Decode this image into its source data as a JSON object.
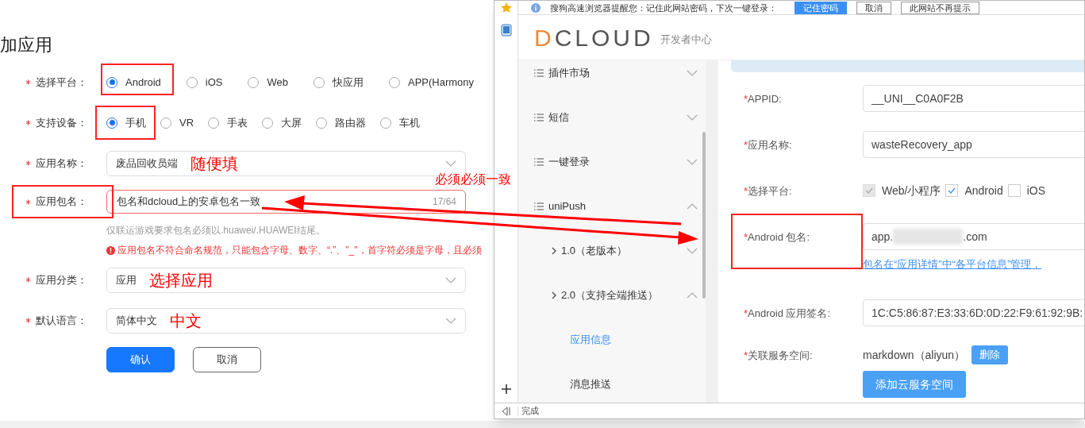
{
  "left_form": {
    "title": "加应用",
    "fields": [
      {
        "kind": "radio",
        "required": true,
        "label": "选择平台：",
        "options": [
          {
            "label": "Android",
            "selected": true
          },
          {
            "label": "iOS",
            "selected": false
          },
          {
            "label": "Web",
            "selected": false
          },
          {
            "label": "快应用",
            "selected": false
          },
          {
            "label": "APP(Harmony",
            "selected": false
          }
        ]
      },
      {
        "kind": "radio",
        "required": true,
        "label": "支持设备：",
        "options": [
          {
            "label": "手机",
            "selected": true
          },
          {
            "label": "VR",
            "selected": false
          },
          {
            "label": "手表",
            "selected": false
          },
          {
            "label": "大屏",
            "selected": false
          },
          {
            "label": "路由器",
            "selected": false
          },
          {
            "label": "车机",
            "selected": false
          }
        ]
      },
      {
        "kind": "select",
        "required": true,
        "label": "应用名称：",
        "value": "废品回收员端",
        "annotation": "随便填"
      },
      {
        "kind": "input",
        "required": true,
        "label": "应用包名：",
        "value": "包名和dcloud上的安卓包名一致",
        "counter": "17/64",
        "hint": "仅联运游戏要求包名必须以.huawei/.HUAWEI结尾。",
        "error": "应用包名不符合命名规范，只能包含字母、数字、“.”、\"_\"，首字符必须是字母，且必须"
      },
      {
        "kind": "select",
        "required": true,
        "label": "应用分类：",
        "value": "应用",
        "annotation": "选择应用"
      },
      {
        "kind": "select",
        "required": true,
        "label": "默认语言：",
        "value": "简体中文",
        "annotation": "中文"
      }
    ],
    "buttons": [
      {
        "label": "确认",
        "kind": "primary"
      },
      {
        "label": "取消",
        "kind": "default"
      }
    ]
  },
  "browser": {
    "notification": {
      "text": "搜狗高速浏览器提醒您：记住此网站密码，下次一键登录：",
      "buttons": [
        {
          "label": "记住密码",
          "kind": "primary"
        },
        {
          "label": "取消",
          "kind": "default"
        },
        {
          "label": "此网站不再提示",
          "kind": "default"
        }
      ]
    },
    "logo": "DCLOUD",
    "logo_subtitle": "开发者中心",
    "sidebar": {
      "items": [
        {
          "label": "插件市场",
          "expanded": false
        },
        {
          "label": "短信",
          "expanded": false
        },
        {
          "label": "一键登录",
          "expanded": false
        },
        {
          "label": "uniPush",
          "expanded": true,
          "children": [
            {
              "label": "1.0（老版本）",
              "expanded": false
            },
            {
              "label": "2.0（支持全端推送）",
              "expanded": true,
              "children": [
                {
                  "label": "应用信息",
                  "selected": true
                },
                {
                  "label": "消息推送",
                  "selected": false
                }
              ]
            }
          ]
        }
      ]
    },
    "form": {
      "rows": [
        {
          "kind": "input",
          "label": "*APPID:",
          "value": "__UNI__C0A0F2B"
        },
        {
          "kind": "input",
          "label": "*应用名称:",
          "value": "wasteRecovery_app"
        },
        {
          "kind": "checks",
          "label": "*选择平台:",
          "options": [
            {
              "label": "Web/小程序",
              "checked": true,
              "disabled": true
            },
            {
              "label": "Android",
              "checked": true,
              "disabled": false
            },
            {
              "label": "iOS",
              "checked": false,
              "disabled": false
            }
          ]
        },
        {
          "kind": "redacted",
          "label": "*Android 包名:",
          "value_prefix": "app.",
          "value_suffix": ".com",
          "link": "包名在“应用详情”中“各平台信息”管理，"
        },
        {
          "kind": "input",
          "label": "*Android 应用签名:",
          "value": "1C:C5:86:87:E3:33:6D:0D:22:F9:61:92:9B:"
        },
        {
          "kind": "space",
          "label": "*关联服务空间:",
          "value": "markdown（aliyun）",
          "delete_button": "删除",
          "add_button": "添加云服务空间"
        }
      ]
    },
    "status_bar": "完成"
  },
  "annotations": [
    {
      "text": "必须必须一致"
    }
  ]
}
